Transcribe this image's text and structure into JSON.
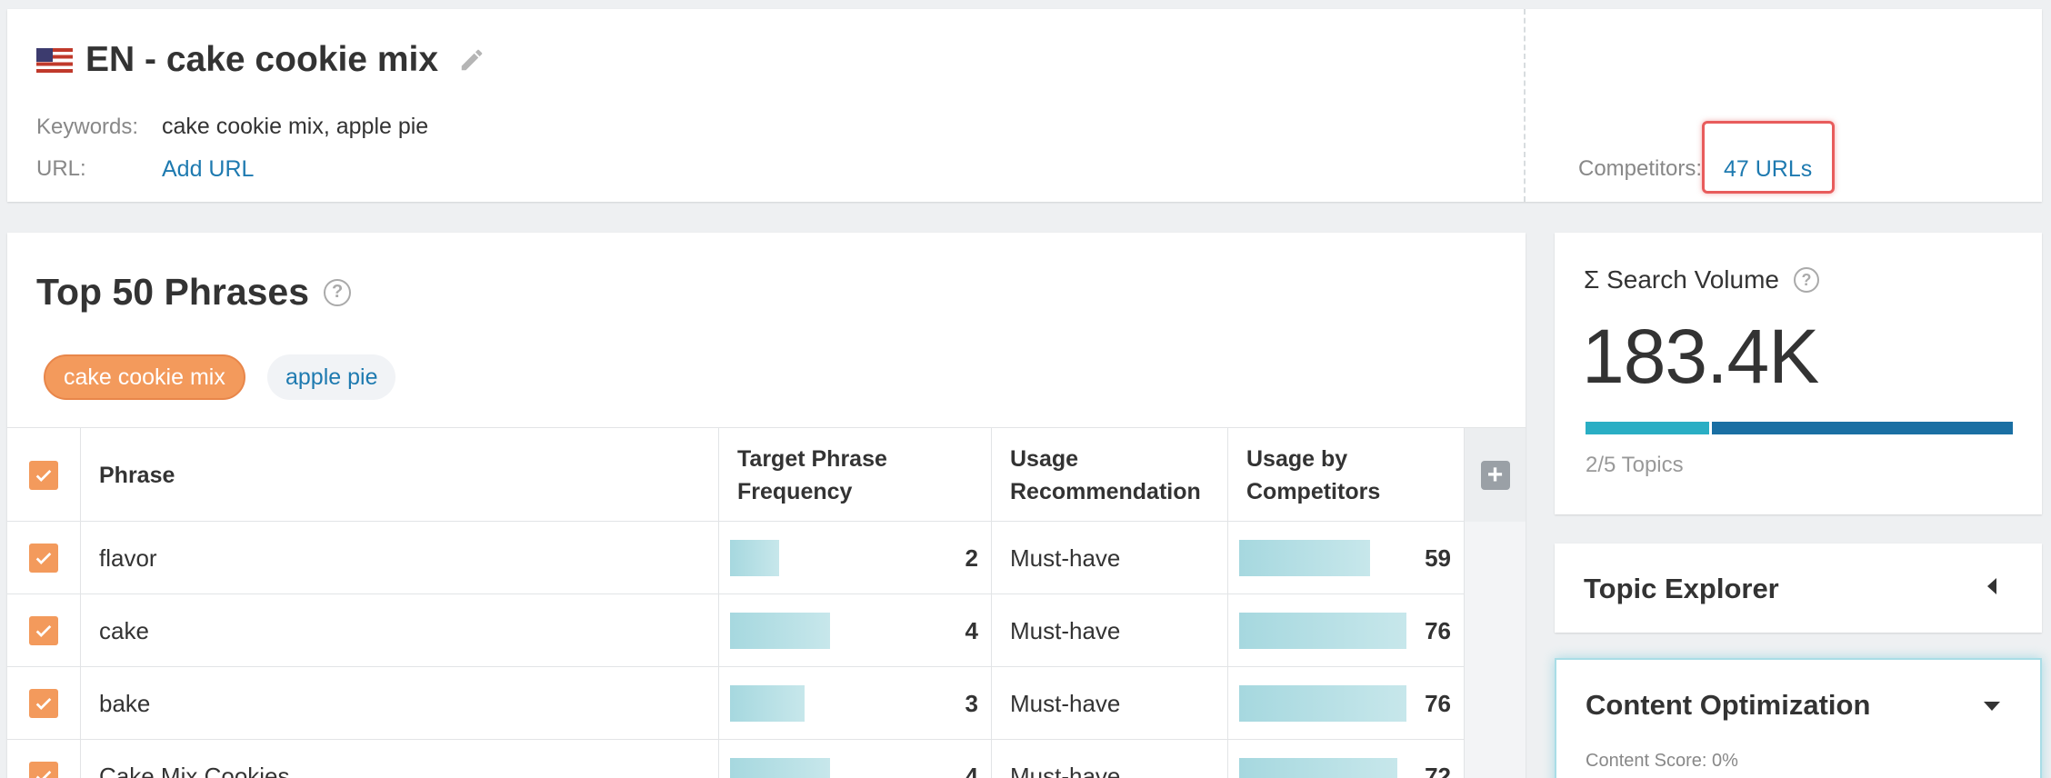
{
  "header": {
    "title": "EN - cake cookie mix",
    "keywords_label": "Keywords:",
    "keywords_value": "cake cookie mix, apple pie",
    "url_label": "URL:",
    "url_link": "Add URL",
    "competitors_label": "Competitors:",
    "competitors_link": "47 URLs"
  },
  "phrases": {
    "title": "Top 50 Phrases",
    "help": "?",
    "tags": [
      "cake cookie mix",
      "apple pie"
    ],
    "columns": {
      "phrase": "Phrase",
      "target_freq": "Target Phrase Frequency",
      "usage_rec": "Usage Recommendation",
      "usage_comp": "Usage by Competitors",
      "add": "+"
    },
    "rows": [
      {
        "phrase": "flavor",
        "target_freq": "2",
        "usage": "Must-have",
        "competitors": "59"
      },
      {
        "phrase": "cake",
        "target_freq": "4",
        "usage": "Must-have",
        "competitors": "76"
      },
      {
        "phrase": "bake",
        "target_freq": "3",
        "usage": "Must-have",
        "competitors": "76"
      },
      {
        "phrase": "Cake Mix Cookies",
        "target_freq": "4",
        "usage": "Must-have",
        "competitors": "72"
      }
    ]
  },
  "search_volume": {
    "title": "Σ Search Volume",
    "help": "?",
    "value": "183.4K",
    "topics": "2/5 Topics"
  },
  "topic_explorer": {
    "title": "Topic Explorer"
  },
  "content_optimization": {
    "title": "Content Optimization",
    "score": "Content Score: 0%"
  },
  "colors": {
    "accent_orange": "#f39a5c",
    "link_blue": "#1e7ab0",
    "bar_teal": "#2aaec4",
    "bar_navy": "#1a6fa3"
  }
}
